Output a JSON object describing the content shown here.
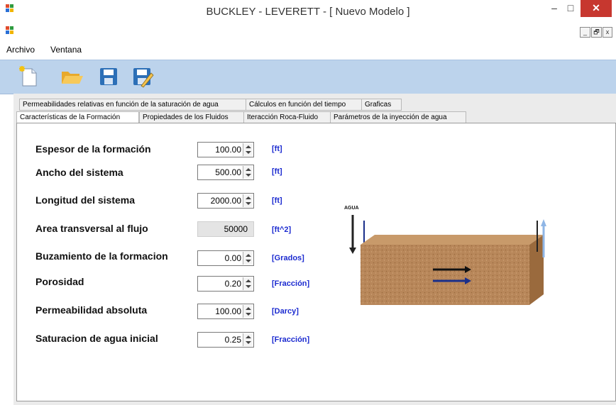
{
  "window": {
    "title": "BUCKLEY - LEVERETT - [ Nuevo Modelo ]",
    "minimize_label": "–",
    "maximize_label": "□",
    "close_label": "✕"
  },
  "mdi": {
    "minimize_label": "_",
    "restore_label": "🗗",
    "close_label": "x"
  },
  "menu": {
    "items": [
      "Archivo",
      "Ventana"
    ]
  },
  "toolbar": {
    "icons": [
      "new-file-icon",
      "open-folder-icon",
      "save-icon",
      "save-as-icon"
    ]
  },
  "tabs": {
    "row1": [
      "Permeabilidades relativas en función de la saturación de agua",
      "Cálculos en función del tiempo",
      "Graficas"
    ],
    "row2": [
      "Características de la Formación",
      "Propiedades de los Fluidos",
      "Iteracción Roca-Fluido",
      "Parámetros de la inyección de agua"
    ],
    "active": "Características de la Formación"
  },
  "form": {
    "fields": [
      {
        "label": "Espesor de la formación",
        "value": "100.00",
        "unit": "[ft]"
      },
      {
        "label": "Ancho del sistema",
        "value": "500.00",
        "unit": "[ft]"
      },
      {
        "label": "Longitud del sistema",
        "value": "2000.00",
        "unit": "[ft]"
      },
      {
        "label": "Area transversal al flujo",
        "value": "50000",
        "unit": "[ft^2]"
      },
      {
        "label": "Buzamiento de la formacion",
        "value": "0.00",
        "unit": "[Grados]"
      },
      {
        "label": "Porosidad",
        "value": "0.20",
        "unit": "[Fracción]"
      },
      {
        "label": "Permeabilidad absoluta",
        "value": "100.00",
        "unit": "[Darcy]"
      },
      {
        "label": "Saturacion de agua inicial",
        "value": "0.25",
        "unit": "[Fracción]"
      }
    ]
  },
  "diagram": {
    "water_label": "AGUA",
    "rock_color": "#b8875a",
    "flow_color_dark": "#111111",
    "flow_color_blue": "#1a2f8a"
  },
  "colors": {
    "toolbar_bg": "#bcd3ec",
    "unit_text": "#1c2bd0",
    "close_btn": "#c7372f"
  }
}
